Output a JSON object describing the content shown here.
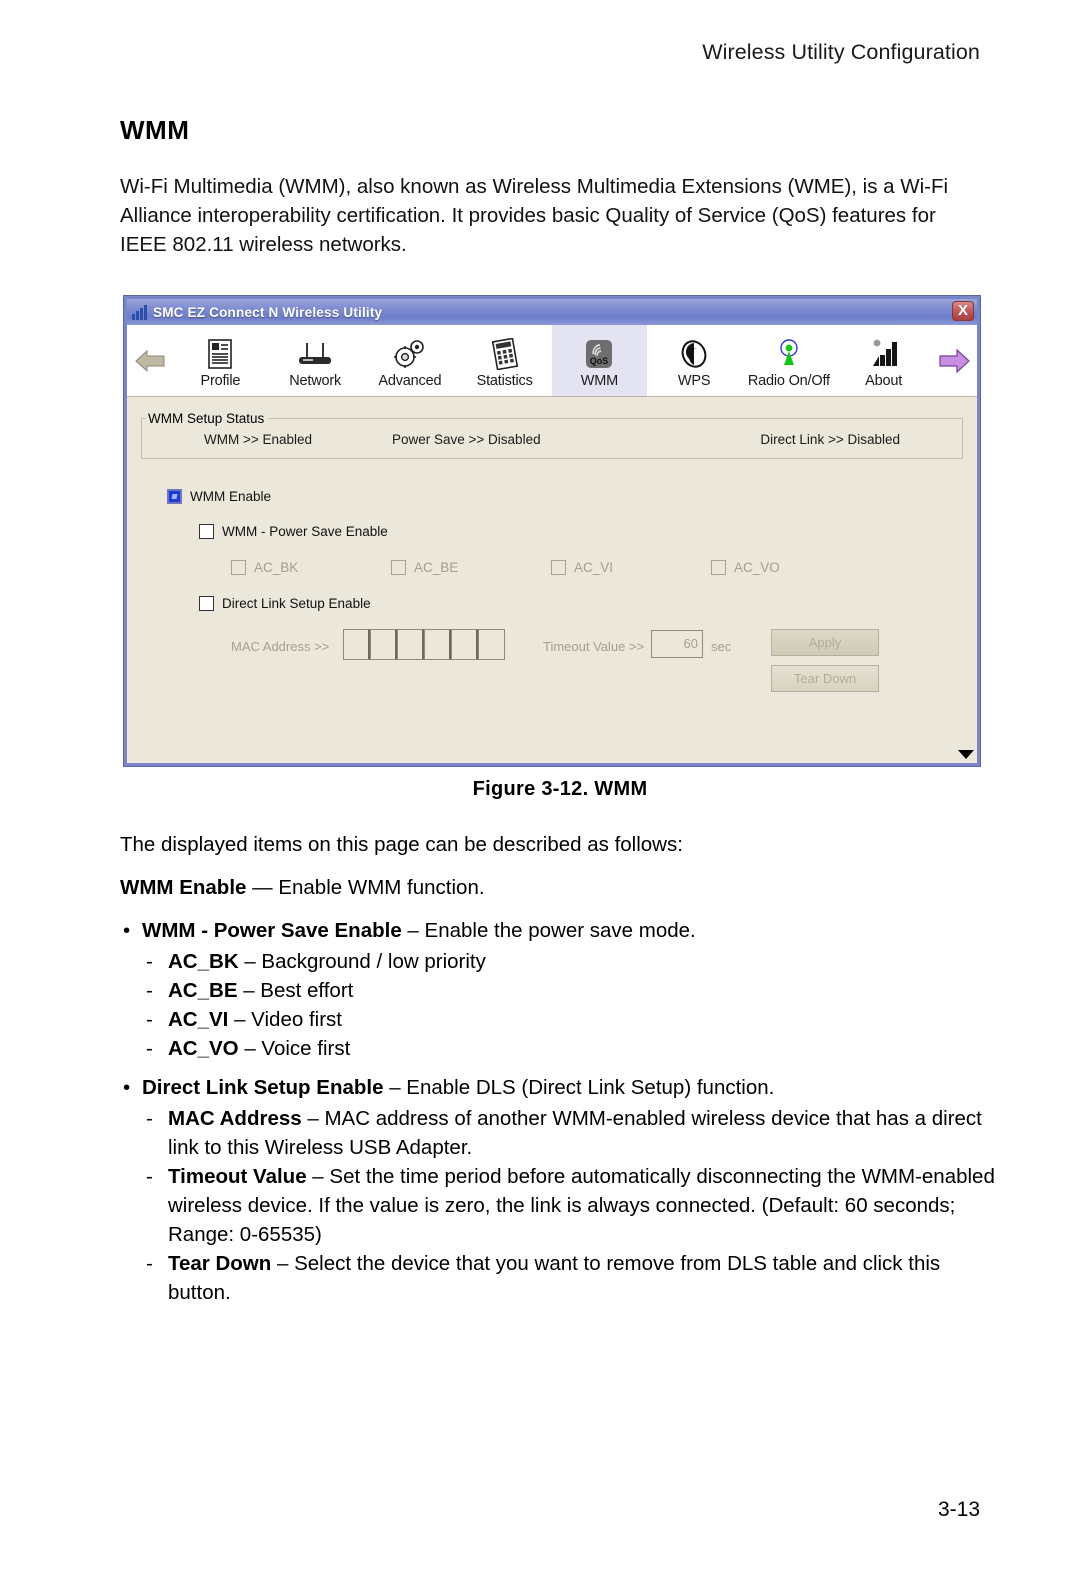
{
  "page": {
    "running_head": "Wireless Utility Configuration",
    "page_number": "3-13",
    "section_title": "WMM",
    "intro_paragraph": "Wi-Fi Multimedia (WMM), also known as Wireless Multimedia Extensions (WME), is a Wi-Fi Alliance interoperability certification. It provides basic Quality of Service (QoS) features for IEEE 802.11 wireless networks.",
    "figure_caption": "Figure 3-12.  WMM"
  },
  "window": {
    "title": "SMC EZ Connect N Wireless Utility",
    "close_label": "X",
    "prev_arrow": "prev-arrow",
    "next_arrow": "next-arrow",
    "scroll_down": "scroll-down-arrow",
    "tabs": [
      {
        "label": "Profile",
        "icon": "profile-icon",
        "active": false
      },
      {
        "label": "Network",
        "icon": "router-icon",
        "active": false
      },
      {
        "label": "Advanced",
        "icon": "gears-icon",
        "active": false
      },
      {
        "label": "Statistics",
        "icon": "calculator-icon",
        "active": false
      },
      {
        "label": "WMM",
        "icon": "qos-icon",
        "active": true
      },
      {
        "label": "WPS",
        "icon": "wps-icon",
        "active": false
      },
      {
        "label": "Radio On/Off",
        "icon": "antenna-icon",
        "active": false
      },
      {
        "label": "About",
        "icon": "bars-icon",
        "active": false
      }
    ],
    "status_group": {
      "legend": "WMM Setup Status",
      "wmm": "WMM >> Enabled",
      "power_save": "Power Save >> Disabled",
      "direct_link": "Direct Link >> Disabled"
    },
    "checkboxes": {
      "wmm_enable": {
        "label": "WMM Enable",
        "checked": true
      },
      "power_save_enable": {
        "label": "WMM - Power Save Enable",
        "checked": false
      },
      "ac_bk": {
        "label": "AC_BK",
        "checked": false
      },
      "ac_be": {
        "label": "AC_BE",
        "checked": false
      },
      "ac_vi": {
        "label": "AC_VI",
        "checked": false
      },
      "ac_vo": {
        "label": "AC_VO",
        "checked": false
      },
      "dls_enable": {
        "label": "Direct Link Setup Enable",
        "checked": false
      }
    },
    "form": {
      "mac_label": "MAC Address >>",
      "mac_octets": [
        "",
        "",
        "",
        "",
        "",
        ""
      ],
      "timeout_label": "Timeout Value >>",
      "timeout_value": "60",
      "timeout_unit": "sec",
      "apply_label": "Apply",
      "tear_down_label": "Tear Down"
    }
  },
  "description": {
    "lead": "The displayed items on this page can be described as follows:",
    "wmm_enable_term": "WMM Enable",
    "wmm_enable_def": " — Enable WMM function.",
    "bullets": [
      {
        "term": "WMM - Power Save Enable",
        "def": " – Enable the power save mode.",
        "subs": [
          {
            "term": "AC_BK",
            "def": " – Background / low priority"
          },
          {
            "term": "AC_BE",
            "def": " – Best effort"
          },
          {
            "term": "AC_VI",
            "def": " – Video first"
          },
          {
            "term": "AC_VO",
            "def": " – Voice first"
          }
        ]
      },
      {
        "term": "Direct Link Setup Enable",
        "def": " – Enable DLS (Direct Link Setup) function.",
        "subs": [
          {
            "term": "MAC Address",
            "def": " – MAC address of another WMM-enabled wireless device that has a direct link to this Wireless USB Adapter."
          },
          {
            "term": "Timeout Value",
            "def": " – Set the time period before automatically disconnecting the WMM-enabled wireless device. If the value is zero, the link is always connected. (Default: 60 seconds; Range: 0-65535)"
          },
          {
            "term": "Tear Down",
            "def": " – Select the device that you want to remove from DLS table and click this button."
          }
        ]
      }
    ],
    "bullet_glyph": "•",
    "dash_glyph": "-"
  }
}
